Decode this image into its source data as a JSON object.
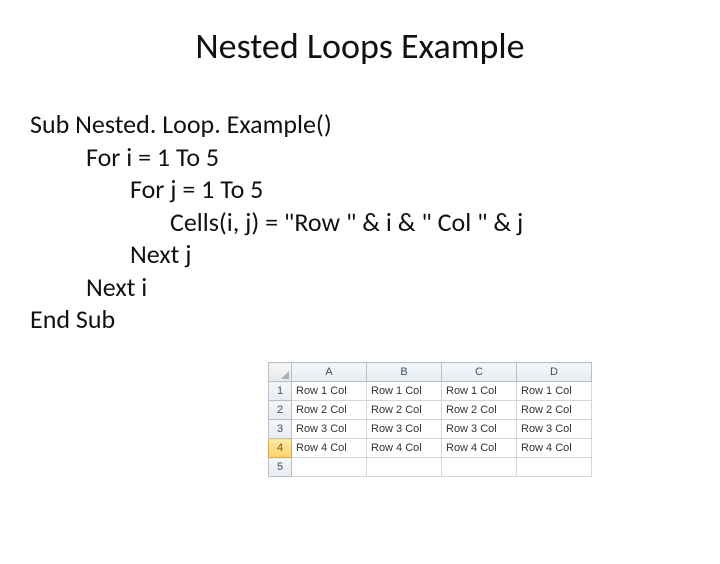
{
  "title": "Nested Loops Example",
  "code": {
    "l1": "Sub Nested. Loop. Example()",
    "l2": "For i = 1 To 5",
    "l3": "For j = 1 To 5",
    "l4": "Cells(i, j) = \"Row \" & i & \"   Col \" & j",
    "l5": "Next j",
    "l6": "Next i",
    "l7": "End Sub"
  },
  "sheet": {
    "cols": [
      "A",
      "B",
      "C",
      "D"
    ],
    "rowNums": [
      "1",
      "2",
      "3",
      "4",
      "5"
    ],
    "selectedRow": 4,
    "cells": [
      [
        "Row 1 Col",
        "Row 1 Col",
        "Row 1 Col",
        "Row 1 Col"
      ],
      [
        "Row 2 Col",
        "Row 2 Col",
        "Row 2 Col",
        "Row 2 Col"
      ],
      [
        "Row 3 Col",
        "Row 3 Col",
        "Row 3 Col",
        "Row 3 Col"
      ],
      [
        "Row 4 Col",
        "Row 4 Col",
        "Row 4 Col",
        "Row 4 Col"
      ],
      [
        "",
        "",
        "",
        ""
      ]
    ]
  }
}
